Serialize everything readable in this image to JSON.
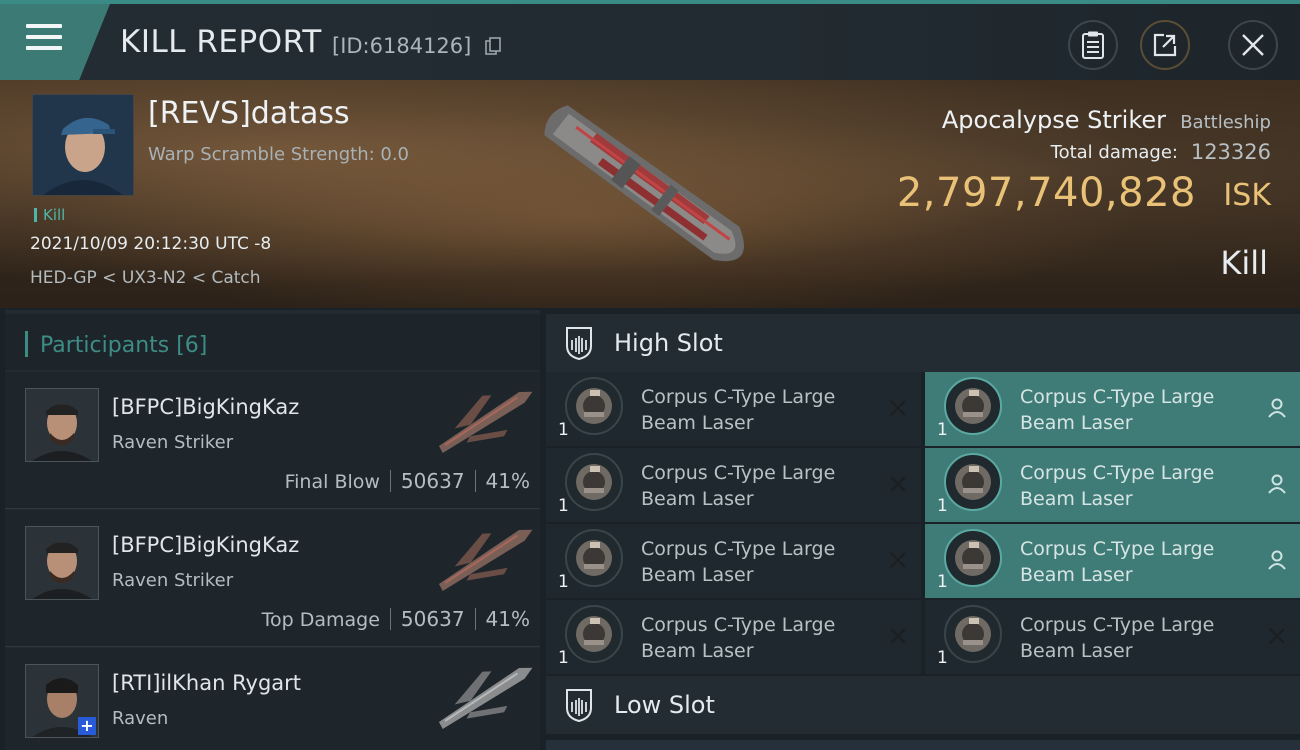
{
  "header": {
    "title": "KILL REPORT",
    "report_id": "[ID:6184126]",
    "buttons": [
      "clipboard-icon",
      "share-icon",
      "close-icon"
    ]
  },
  "victim": {
    "pilot": "[REVS]datass",
    "warp_scramble": "Warp Scramble Strength: 0.0",
    "kill_tag": "Kill",
    "datetime": "2021/10/09 20:12:30 UTC -8",
    "route": "HED-GP < UX3-N2 < Catch",
    "ship_name": "Apocalypse Striker",
    "ship_class": "Battleship",
    "total_damage_label": "Total damage:",
    "total_damage": "123326",
    "isk_value": "2,797,740,828",
    "isk_unit": "ISK",
    "result": "Kill"
  },
  "participants": {
    "title": "Participants [6]",
    "rows": [
      {
        "name": "[BFPC]BigKingKaz",
        "ship": "Raven Striker",
        "label": "Final Blow",
        "damage": "50637",
        "percent": "41%"
      },
      {
        "name": "[BFPC]BigKingKaz",
        "ship": "Raven Striker",
        "label": "Top Damage",
        "damage": "50637",
        "percent": "41%"
      },
      {
        "name": "[RTI]ilKhan Rygart",
        "ship": "Raven",
        "label": "",
        "damage": "",
        "percent": ""
      }
    ]
  },
  "slots": {
    "high_title": "High Slot",
    "low_title": "Low Slot",
    "high_modules": [
      {
        "name1": "Corpus C-Type Large",
        "name2": "Beam Laser",
        "qty": "1",
        "status": "destroyed"
      },
      {
        "name1": "Corpus C-Type Large",
        "name2": "Beam Laser",
        "qty": "1",
        "status": "destroyed"
      },
      {
        "name1": "Corpus C-Type Large",
        "name2": "Beam Laser",
        "qty": "1",
        "status": "destroyed"
      },
      {
        "name1": "Corpus C-Type Large",
        "name2": "Beam Laser",
        "qty": "1",
        "status": "destroyed"
      },
      {
        "name1": "Corpus C-Type Large",
        "name2": "Beam Laser",
        "qty": "1",
        "status": "dropped"
      },
      {
        "name1": "Corpus C-Type Large",
        "name2": "Beam Laser",
        "qty": "1",
        "status": "dropped"
      },
      {
        "name1": "Corpus C-Type Large",
        "name2": "Beam Laser",
        "qty": "1",
        "status": "dropped"
      },
      {
        "name1": "Corpus C-Type Large",
        "name2": "Beam Laser",
        "qty": "1",
        "status": "destroyed"
      }
    ]
  },
  "colors": {
    "accent": "#3c7a76",
    "isk": "#e9c277",
    "fitted_bg": "#3f7c78"
  }
}
